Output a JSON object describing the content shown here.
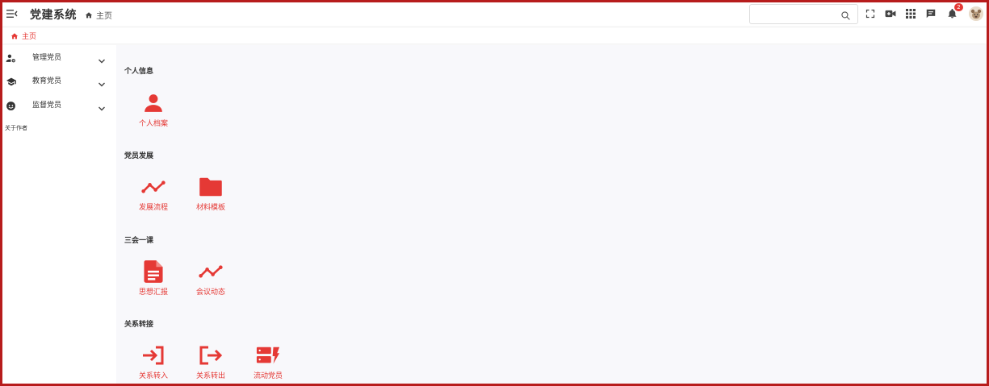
{
  "colors": {
    "accent": "#e53935",
    "frame": "#b71c1c",
    "main_bg": "#f8f8fb"
  },
  "header": {
    "menu_icon": "menu-fold-icon",
    "app_title": "党建系统",
    "breadcrumb": {
      "icon": "home-icon",
      "label": "主页"
    },
    "search": {
      "placeholder": "",
      "value": "",
      "icon": "search-icon"
    },
    "icons": [
      "fullscreen-icon",
      "video-icon",
      "apps-grid-icon",
      "message-icon",
      "bell-icon"
    ],
    "notification_count": "2",
    "avatar": "avatar"
  },
  "tabs": [
    {
      "label": "主页",
      "icon": "home-icon",
      "active": true
    }
  ],
  "sidebar": {
    "items": [
      {
        "label": "管理党员",
        "icon": "user-manage-icon"
      },
      {
        "label": "教育党员",
        "icon": "graduation-cap-icon"
      },
      {
        "label": "监督党员",
        "icon": "face-icon"
      }
    ],
    "about": "关于作者"
  },
  "sections": [
    {
      "title": "个人信息",
      "items": [
        {
          "label": "个人档案",
          "icon": "person-icon"
        }
      ]
    },
    {
      "title": "党员发展",
      "items": [
        {
          "label": "发展流程",
          "icon": "trend-icon"
        },
        {
          "label": "材料模板",
          "icon": "folder-icon"
        }
      ]
    },
    {
      "title": "三会一课",
      "items": [
        {
          "label": "思想汇报",
          "icon": "document-icon"
        },
        {
          "label": "会议动态",
          "icon": "trend-icon"
        }
      ]
    },
    {
      "title": "关系转接",
      "items": [
        {
          "label": "关系转入",
          "icon": "login-icon"
        },
        {
          "label": "关系转出",
          "icon": "logout-icon"
        },
        {
          "label": "流动党员",
          "icon": "storage-flash-icon"
        }
      ]
    }
  ]
}
